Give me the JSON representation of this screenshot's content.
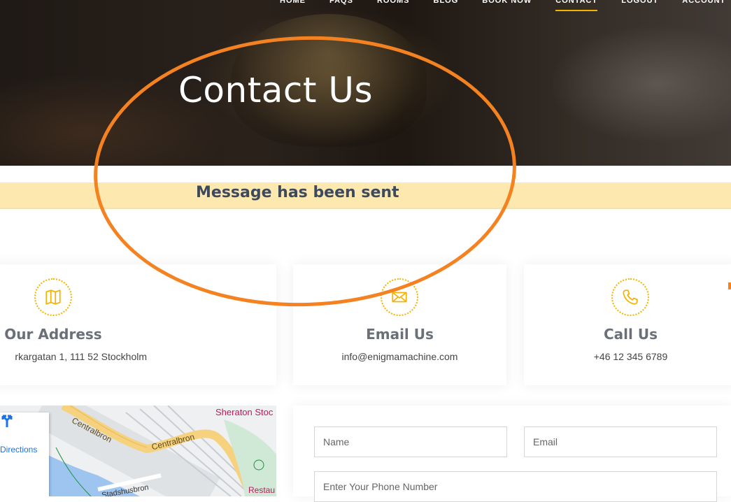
{
  "nav": {
    "items": [
      "HOME",
      "FAQS",
      "ROOMS",
      "BLOG",
      "BOOK NOW",
      "CONTACT",
      "LOGOUT",
      "ACCOUNT"
    ],
    "active": "CONTACT",
    "accent": "#f5b300"
  },
  "hero": {
    "title": "Contact Us"
  },
  "alert": {
    "message": "Message has been sent",
    "background": "#fde9b0"
  },
  "cards": [
    {
      "icon": "map-icon",
      "title": "Our Address",
      "detail": "rkargatan 1, 111 52 Stockholm"
    },
    {
      "icon": "envelope-icon",
      "title": "Email Us",
      "detail": "info@enigmamachine.com"
    },
    {
      "icon": "phone-icon",
      "title": "Call Us",
      "detail": "+46 12 345 6789"
    }
  ],
  "map": {
    "directions_label": "Directions",
    "labels": [
      "Sheraton Stoc",
      "Centralbron",
      "Centralbron",
      "Stadshusbron",
      "Restau"
    ]
  },
  "form": {
    "name_placeholder": "Name",
    "email_placeholder": "Email",
    "phone_placeholder": "Enter Your Phone Number"
  },
  "annotation_color": "#f58220"
}
